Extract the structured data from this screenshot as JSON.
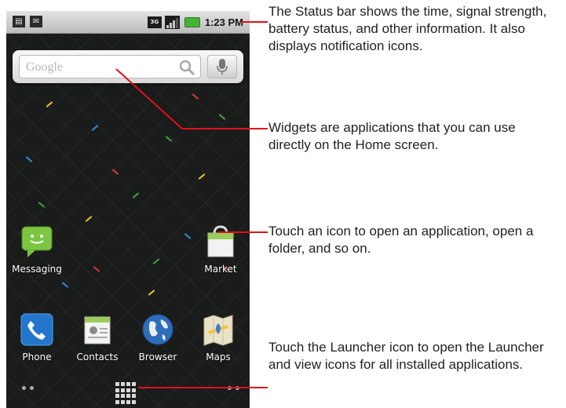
{
  "status_bar": {
    "notification_icons": [
      "sim-card-icon",
      "email-icon"
    ],
    "network": "3G",
    "time": "1:23 PM"
  },
  "search_widget": {
    "placeholder": "Google",
    "icons": [
      "magnifier-icon",
      "microphone-icon"
    ]
  },
  "apps": {
    "messaging": "Messaging",
    "market": "Market",
    "phone": "Phone",
    "contacts": "Contacts",
    "browser": "Browser",
    "maps": "Maps"
  },
  "page_dots": {
    "left": "••",
    "right": "••"
  },
  "callouts": {
    "status_bar": "The Status bar shows the time, signal strength, battery status, and other information. It also displays notification icons.",
    "widgets": "Widgets are applications that you can use directly on the Home screen.",
    "icons": "Touch an icon to open an application, open a folder, and so on.",
    "launcher": "Touch the Launcher icon to open the Launcher and view icons for all installed applications."
  },
  "colors": {
    "callout_line": "#e0101a",
    "battery": "#44b336",
    "wallpaper": "#1a1c1b"
  }
}
